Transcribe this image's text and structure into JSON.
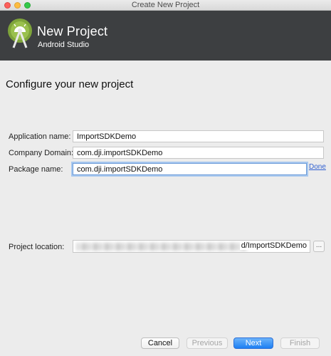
{
  "window": {
    "title": "Create New Project"
  },
  "header": {
    "title": "New Project",
    "subtitle": "Android Studio"
  },
  "section": {
    "title": "Configure your new project"
  },
  "form": {
    "application_name": {
      "label": "Application name:",
      "value": "ImportSDKDemo"
    },
    "company_domain": {
      "label": "Company Domain:",
      "value": "com.dji.importSDKDemo"
    },
    "package_name": {
      "label": "Package name:",
      "value": "com.dji.importSDKDemo",
      "action": "Done"
    },
    "project_location": {
      "label": "Project location:",
      "visible_suffix": "d/ImportSDKDemo",
      "browse": "..."
    }
  },
  "footer": {
    "cancel": "Cancel",
    "previous": "Previous",
    "next": "Next",
    "finish": "Finish"
  },
  "colors": {
    "header_bg": "#3d3f41",
    "accent_blue": "#1d7ff3",
    "android_green": "#a4c639"
  }
}
